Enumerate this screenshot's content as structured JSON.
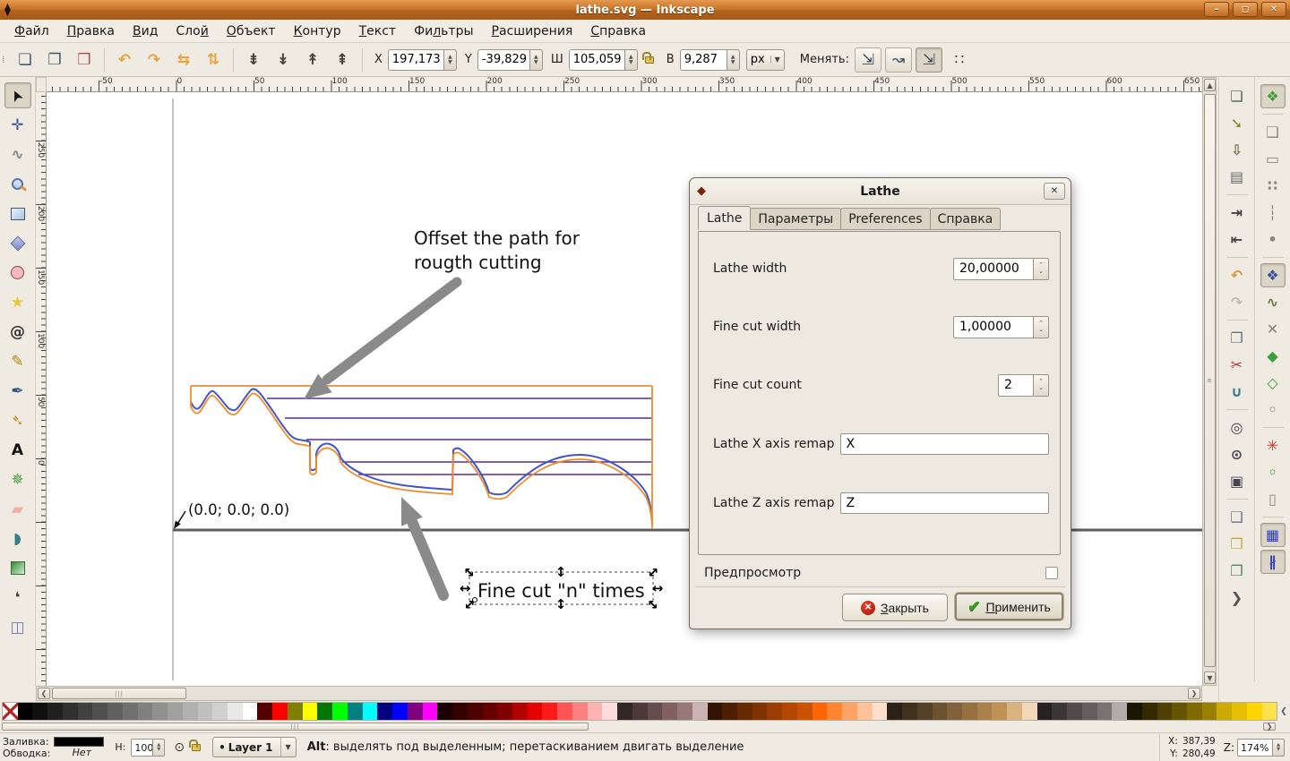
{
  "window": {
    "title": "lathe.svg — Inkscape",
    "minimize": "–",
    "maximize": "◻",
    "close": "✕"
  },
  "menubar": {
    "items": [
      {
        "label": "Файл",
        "accel": 0
      },
      {
        "label": "Правка",
        "accel": 0
      },
      {
        "label": "Вид",
        "accel": 0
      },
      {
        "label": "Слой",
        "accel": 3
      },
      {
        "label": "Объект",
        "accel": 0
      },
      {
        "label": "Контур",
        "accel": 0
      },
      {
        "label": "Текст",
        "accel": 0
      },
      {
        "label": "Фильтры",
        "accel": 2
      },
      {
        "label": "Расширения",
        "accel": 0
      },
      {
        "label": "Справка",
        "accel": 0
      }
    ]
  },
  "toolbar": {
    "x_label": "X",
    "x_value": "197,173",
    "y_label": "Y",
    "y_value": "-39,829",
    "w_label": "Ш",
    "w_value": "105,059",
    "h_label": "В",
    "h_value": "9,287",
    "units": "px",
    "affect_label": "Менять:",
    "buttons": [
      {
        "name": "select-all-button",
        "glyph": "❏",
        "color": "#41526b"
      },
      {
        "name": "select-all-layers-button",
        "glyph": "❐",
        "color": "#41526b"
      },
      {
        "name": "deselect-button",
        "glyph": "❒",
        "color": "#b05050"
      },
      {
        "sep": true
      },
      {
        "name": "rotate-ccw-button",
        "glyph": "↶",
        "color": "#e8a33d"
      },
      {
        "name": "rotate-cw-button",
        "glyph": "↷",
        "color": "#e8a33d"
      },
      {
        "name": "flip-horizontal-button",
        "glyph": "⇆",
        "color": "#e8a33d"
      },
      {
        "name": "flip-vertical-button",
        "glyph": "⇅",
        "color": "#e8a33d"
      },
      {
        "sep": true
      },
      {
        "name": "lower-to-bottom-button",
        "glyph": "⇟",
        "color": "#4a4336"
      },
      {
        "name": "lower-button",
        "glyph": "↡",
        "color": "#4a4336"
      },
      {
        "name": "raise-button",
        "glyph": "↟",
        "color": "#4a4336"
      },
      {
        "name": "raise-to-top-button",
        "glyph": "⇞",
        "color": "#4a4336"
      }
    ],
    "affect_buttons": [
      {
        "name": "affect-move-toggle",
        "glyph": "⇲",
        "pressed": false
      },
      {
        "name": "affect-transform-toggle",
        "glyph": "↝",
        "pressed": false
      },
      {
        "name": "affect-corners-toggle",
        "glyph": "⇲",
        "pressed": true
      },
      {
        "name": "affect-pattern-icon",
        "glyph": "∷",
        "pressed": false,
        "flat": true
      }
    ]
  },
  "rulers": {
    "h_labels": [
      "-50",
      "0",
      "50",
      "100",
      "150",
      "200",
      "250",
      "300",
      "350",
      "400",
      "450",
      "500",
      "550",
      "600",
      "650"
    ],
    "v_labels": [
      "250",
      "200",
      "150",
      "100",
      "50",
      "0"
    ]
  },
  "toolbox": {
    "tools": [
      {
        "name": "selector-tool",
        "glyph": "➤",
        "color": "#111",
        "rot": -115,
        "active": true
      },
      {
        "name": "node-tool",
        "glyph": "✛",
        "color": "#3a4f9b"
      },
      {
        "name": "tweak-tool",
        "glyph": "∿",
        "color": "#7a8894"
      },
      {
        "name": "zoom-tool",
        "shape": "sh-mag"
      },
      {
        "name": "rectangle-tool",
        "shape": "sh-rect"
      },
      {
        "name": "box3d-tool",
        "shape": "sh-cube"
      },
      {
        "name": "ellipse-tool",
        "shape": "sh-circ"
      },
      {
        "name": "star-tool",
        "glyph": "★",
        "color": "#e9c63a"
      },
      {
        "name": "spiral-tool",
        "glyph": "@",
        "color": "#333"
      },
      {
        "name": "pencil-tool",
        "glyph": "✎",
        "color": "#b8860b"
      },
      {
        "name": "pen-tool",
        "glyph": "✒",
        "color": "#33517c"
      },
      {
        "name": "calligraphy-tool",
        "glyph": "➴",
        "color": "#c09020"
      },
      {
        "name": "text-tool",
        "glyph": "A",
        "color": "#111"
      },
      {
        "name": "spray-tool",
        "glyph": "✵",
        "color": "#4d9b3a"
      },
      {
        "name": "eraser-tool",
        "glyph": "▰",
        "color": "#f0b0a0"
      },
      {
        "name": "bucket-tool",
        "glyph": "◗",
        "color": "#3a7b8c"
      },
      {
        "name": "gradient-tool",
        "shape": "sh-grad"
      },
      {
        "name": "dropper-tool",
        "glyph": "❛",
        "color": "#444"
      },
      {
        "name": "connector-tool",
        "glyph": "◫",
        "color": "#6b7bb5"
      }
    ]
  },
  "commands_bar": {
    "items": [
      {
        "name": "new-document-button",
        "glyph": "❏",
        "color": "#50614f"
      },
      {
        "name": "open-document-button",
        "glyph": "➘",
        "color": "#7b8a25"
      },
      {
        "name": "save-document-button",
        "glyph": "⇩",
        "color": "#7a6a4a"
      },
      {
        "name": "print-button",
        "glyph": "▤",
        "color": "#666"
      },
      {
        "sep": true
      },
      {
        "name": "import-button",
        "glyph": "⇥",
        "color": "#444"
      },
      {
        "name": "export-button",
        "glyph": "⇤",
        "color": "#444"
      },
      {
        "sep": true
      },
      {
        "name": "undo-button",
        "glyph": "↶",
        "color": "#d89a3c"
      },
      {
        "name": "redo-button",
        "glyph": "↷",
        "color": "#c2bbac"
      },
      {
        "sep": true
      },
      {
        "name": "copy-button",
        "glyph": "❐",
        "color": "#667085"
      },
      {
        "name": "cut-button",
        "glyph": "✂",
        "color": "#a33"
      },
      {
        "name": "paste-button",
        "glyph": "∪",
        "color": "#3a7b8c"
      },
      {
        "sep": true
      },
      {
        "name": "zoom-selection-button",
        "glyph": "◎",
        "color": "#445"
      },
      {
        "name": "zoom-drawing-button",
        "glyph": "⊙",
        "color": "#445"
      },
      {
        "name": "zoom-page-button",
        "glyph": "▣",
        "color": "#445"
      },
      {
        "sep": true
      },
      {
        "name": "duplicate-button",
        "glyph": "❑",
        "color": "#667085"
      },
      {
        "name": "clone-button",
        "glyph": "❒",
        "color": "#caa83c"
      },
      {
        "name": "unlink-clone-button",
        "glyph": "❒",
        "color": "#4a8a5a"
      },
      {
        "name": "commands-overflow-button",
        "glyph": "❯",
        "color": "#555"
      }
    ]
  },
  "snap_bar": {
    "items": [
      {
        "name": "snap-enable-toggle",
        "glyph": "❖",
        "color": "#3aa03a",
        "active": true
      },
      {
        "sep": true
      },
      {
        "name": "snap-bbox-toggle",
        "glyph": "❑",
        "color": "#8a8478"
      },
      {
        "name": "snap-bbox-edges-toggle",
        "glyph": "▭",
        "color": "#8a8478"
      },
      {
        "name": "snap-bbox-corners-toggle",
        "glyph": "∷",
        "color": "#8a8478"
      },
      {
        "name": "snap-bbox-midpoints-toggle",
        "glyph": "┆",
        "color": "#8a8478"
      },
      {
        "name": "snap-bbox-centers-toggle",
        "glyph": "•",
        "color": "#8a8478"
      },
      {
        "sep": true
      },
      {
        "name": "snap-nodes-toggle",
        "glyph": "❖",
        "color": "#3a4f9b",
        "active": true
      },
      {
        "name": "snap-paths-toggle",
        "glyph": "∿",
        "color": "#6a7a3a"
      },
      {
        "name": "snap-intersections-toggle",
        "glyph": "✕",
        "color": "#8a8478"
      },
      {
        "name": "snap-cusp-nodes-toggle",
        "glyph": "◆",
        "color": "#3aa03a"
      },
      {
        "name": "snap-smooth-nodes-toggle",
        "glyph": "◇",
        "color": "#3aa03a"
      },
      {
        "name": "snap-midpoints-toggle",
        "glyph": "◦",
        "color": "#8a8478"
      },
      {
        "sep": true
      },
      {
        "name": "snap-object-centers-toggle",
        "glyph": "✳",
        "color": "#c03a2a"
      },
      {
        "name": "snap-rotation-centers-toggle",
        "glyph": "◦",
        "color": "#3aa03a"
      },
      {
        "name": "snap-page-border-toggle",
        "glyph": "▯",
        "color": "#8a8478"
      },
      {
        "sep": true
      },
      {
        "name": "snap-grid-toggle",
        "glyph": "▦",
        "color": "#2a3ad0",
        "active": true
      },
      {
        "name": "snap-guides-toggle",
        "glyph": "∦",
        "color": "#2a3ad0",
        "active": true
      }
    ]
  },
  "canvas": {
    "origin_label": "(0.0; 0.0; 0.0)",
    "annotation_line1": "Offset the path for",
    "annotation_line2": "rougth cutting",
    "selected_text": "Fine cut \"n\" times",
    "colors": {
      "profile": "#f28c28",
      "offset": "#4553c8",
      "cut_lines": "#5b2d91",
      "arrow": "#8a8a8a",
      "axis": "#5c5c5c",
      "page_border": "#8a8a8a"
    }
  },
  "dialog": {
    "title": "Lathe",
    "close_glyph": "✕",
    "tabs": [
      {
        "label": "Lathe",
        "active": true
      },
      {
        "label": "Параметры",
        "active": false
      },
      {
        "label": "Preferences",
        "active": false
      },
      {
        "label": "Справка",
        "active": false
      }
    ],
    "fields": [
      {
        "label": "Lathe width",
        "value": "20,00000"
      },
      {
        "label": "Fine cut width",
        "value": "1,00000"
      },
      {
        "label": "Fine cut count",
        "value": "2"
      },
      {
        "label": "Lathe X axis remap",
        "value": "X"
      },
      {
        "label": "Lathe Z axis remap",
        "value": "Z"
      }
    ],
    "preview_label": "Предпросмотр",
    "buttons": {
      "close": {
        "label": "Закрыть",
        "accel": 0
      },
      "apply": {
        "label": "Применить",
        "accel": 0
      }
    }
  },
  "palette": {
    "colors": [
      "none",
      "#000000",
      "#101010",
      "#202020",
      "#303030",
      "#404040",
      "#505050",
      "#606060",
      "#707070",
      "#808080",
      "#909090",
      "#a0a0a0",
      "#b0b0b0",
      "#c0c0c0",
      "#d0d0d0",
      "#e8e8e8",
      "#ffffff",
      "#550000",
      "#ff0000",
      "#808000",
      "#ffff00",
      "#007800",
      "#00ff00",
      "#008080",
      "#00ffff",
      "#000080",
      "#0000ff",
      "#800080",
      "#ff00ff",
      "#1a0000",
      "#330000",
      "#4d0000",
      "#660000",
      "#800000",
      "#b30000",
      "#e60000",
      "#ff1a1a",
      "#ff5555",
      "#ff8080",
      "#ffb3b3",
      "#ffdddd",
      "#332626",
      "#4d3939",
      "#664d4d",
      "#806060",
      "#997878",
      "#ccb3b3",
      "#331400",
      "#4d1f00",
      "#662900",
      "#803300",
      "#993d00",
      "#b34700",
      "#cc5200",
      "#ff6600",
      "#ff8533",
      "#ffa366",
      "#ffc299",
      "#ffe0cc",
      "#2b2117",
      "#40311f",
      "#554128",
      "#6a5130",
      "#806139",
      "#957141",
      "#aa814a",
      "#bf9152",
      "#d9b380",
      "#f0d8b8",
      "#262222",
      "#3b3636",
      "#504a4a",
      "#655e5e",
      "#7a7272",
      "#b3aaaa",
      "#1a1500",
      "#332a00",
      "#4d4000",
      "#665500",
      "#806a00",
      "#998000",
      "#ccaa00",
      "#e6c000",
      "#ffd500",
      "#ffe14d"
    ]
  },
  "statusbar": {
    "fill_label": "Заливка:",
    "stroke_label": "Обводка:",
    "stroke_value": "Нет",
    "opacity_label": "Н:",
    "opacity_value": "100",
    "layer_label": "Layer 1",
    "message_prefix": "Alt",
    "message_rest": ": выделять под выделенным; перетаскиванием двигать выделение",
    "x_label": "X:",
    "x_value": "387,39",
    "y_label": "Y:",
    "y_value": "280,49",
    "zoom_label": "Z:",
    "zoom_value": "174%"
  }
}
